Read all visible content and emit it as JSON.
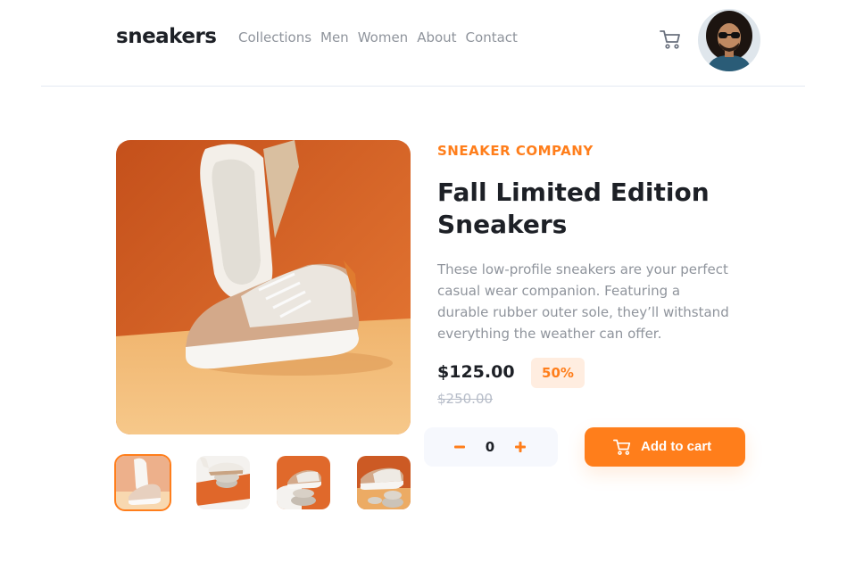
{
  "header": {
    "logo": "sneakers",
    "nav": [
      "Collections",
      "Men",
      "Women",
      "About",
      "Contact"
    ]
  },
  "icons": {
    "cart": "cart-icon",
    "avatar": "user-avatar",
    "minus": "minus-icon",
    "plus": "plus-icon"
  },
  "product": {
    "company": "SNEAKER COMPANY",
    "title": "Fall Limited Edition Sneakers",
    "description": "These low-profile sneakers are your perfect casual wear companion. Featuring a durable rubber outer sole, they’ll withstand everything the weather can offer.",
    "price": "$125.00",
    "discount": "50%",
    "original_price": "$250.00",
    "quantity": "0",
    "add_to_cart": "Add to cart",
    "selected_thumbnail": 1
  },
  "colors": {
    "accent": "#ff7e1b",
    "accent_light": "#ffede0",
    "text_dark": "#1d2026",
    "text_grey": "#8f949c"
  }
}
